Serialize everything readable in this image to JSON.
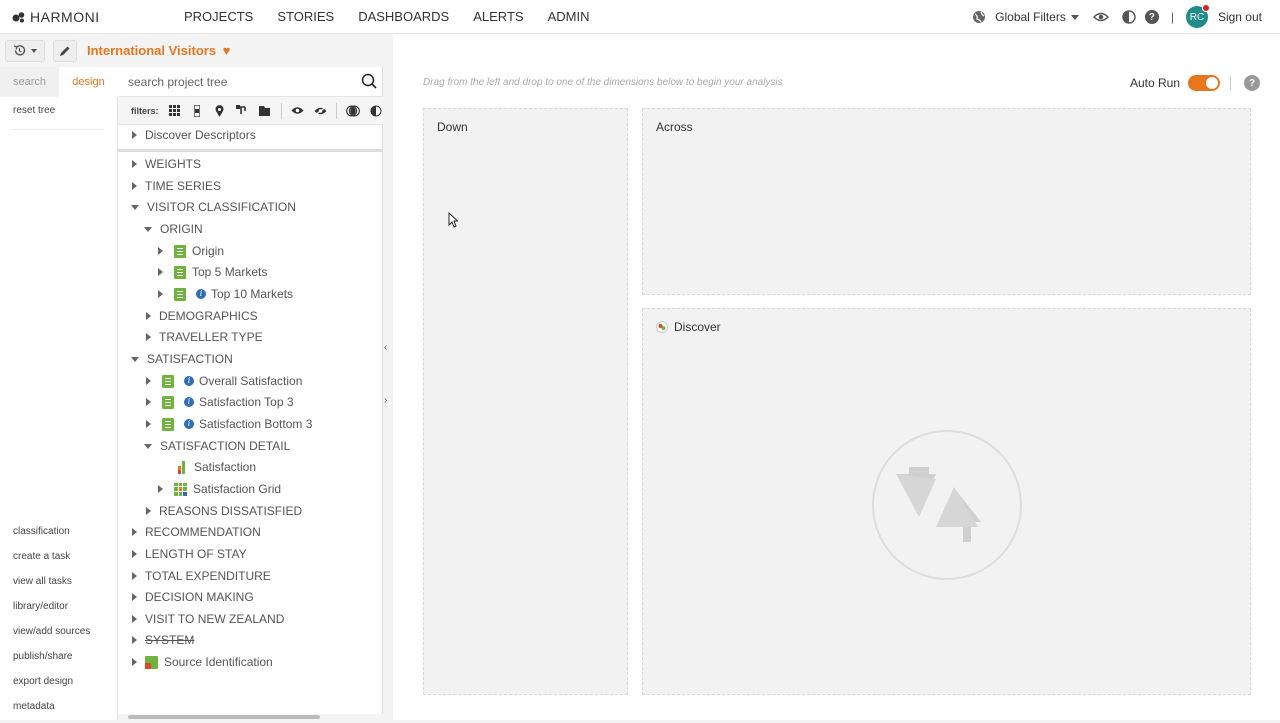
{
  "app": {
    "brand": "HARMONI"
  },
  "nav": [
    "PROJECTS",
    "STORIES",
    "DASHBOARDS",
    "ALERTS",
    "ADMIN"
  ],
  "topright": {
    "global_filters": "Global Filters",
    "avatar": "RC",
    "signout": "Sign out"
  },
  "project": {
    "title": "International Visitors"
  },
  "sidetabs": {
    "search": "search",
    "design": "design"
  },
  "sidemenu": {
    "reset": "reset tree",
    "links": [
      "classification",
      "create a task",
      "view all tasks",
      "library/editor",
      "view/add sources",
      "publish/share",
      "export design",
      "metadata"
    ]
  },
  "tree": {
    "search_placeholder": "search project tree",
    "filters_label": "filters:",
    "items": [
      "Discover Descriptors",
      "WEIGHTS",
      "TIME SERIES",
      "VISITOR CLASSIFICATION",
      "ORIGIN",
      "Origin",
      "Top 5 Markets",
      "Top 10 Markets",
      "DEMOGRAPHICS",
      "TRAVELLER TYPE",
      "SATISFACTION",
      "Overall Satisfaction",
      "Satisfaction Top 3",
      "Satisfaction Bottom 3",
      "SATISFACTION DETAIL",
      "Satisfaction",
      "Satisfaction Grid",
      "REASONS DISSATISFIED",
      "RECOMMENDATION",
      "LENGTH OF STAY",
      "TOTAL EXPENDITURE",
      "DECISION MAKING",
      "VISIT TO NEW ZEALAND",
      "SYSTEM",
      "Source Identification"
    ]
  },
  "main": {
    "hint": "Drag from the left and drop to one of the dimensions below to begin your analysis",
    "autorun": "Auto Run",
    "zones": {
      "down": "Down",
      "across": "Across",
      "discover": "Discover"
    }
  },
  "colors": {
    "accent": "#e8761e",
    "green": "#6fb23f",
    "info": "#2f6db5",
    "avatar": "#1f8c8a"
  }
}
